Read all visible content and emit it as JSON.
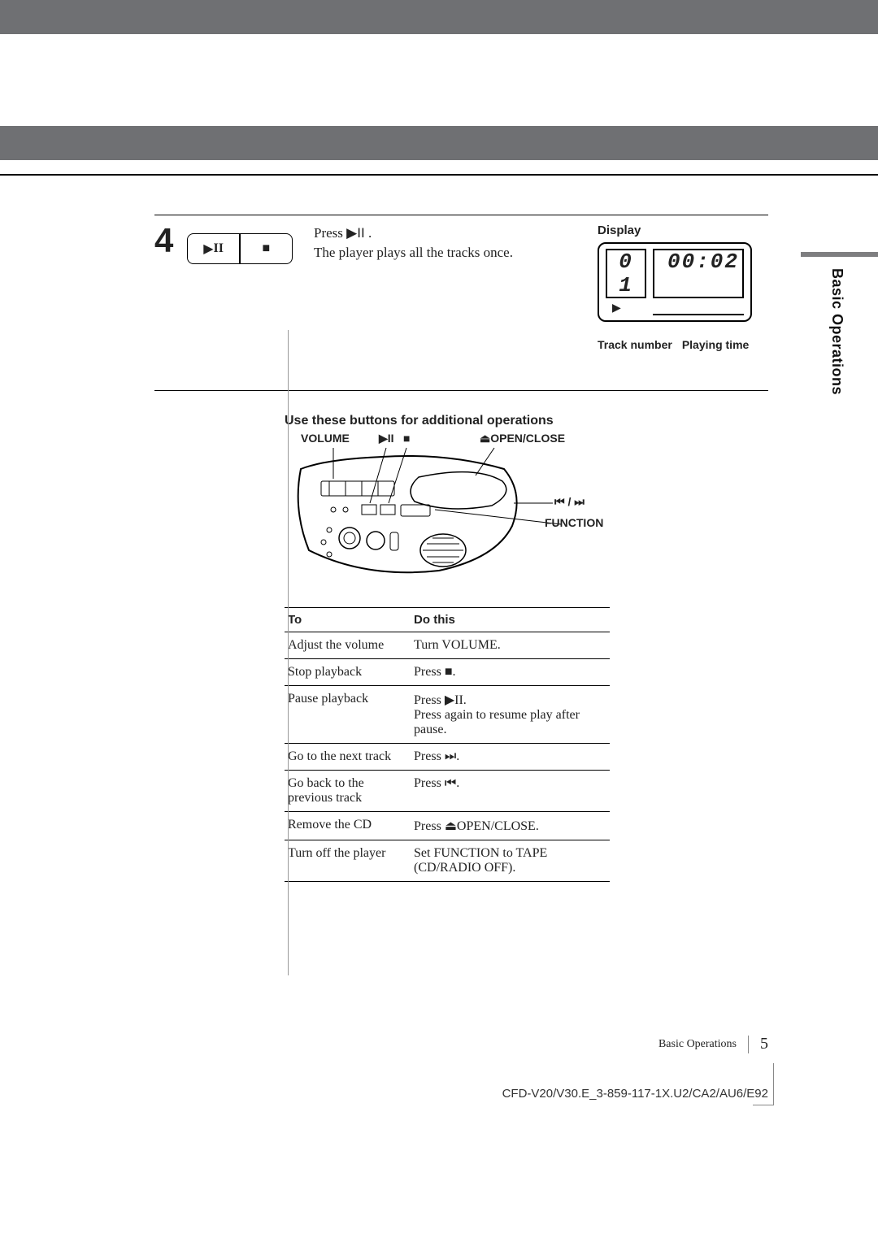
{
  "side_tab": "Basic Operations",
  "step": {
    "number": "4",
    "instruction_line1_prefix": "Press ",
    "instruction_line1_symbol": "▶II",
    "instruction_line1_suffix": " .",
    "instruction_line2": "The  player plays all the tracks once."
  },
  "display": {
    "label": "Display",
    "track": "0 1",
    "time": "00:02",
    "caption_left": "Track number",
    "caption_right": "Playing time"
  },
  "subhead": "Use these buttons for additional operations",
  "device_labels": {
    "volume": "VOLUME",
    "playpause": "▶II",
    "stop": "■",
    "openclose_sym": "⏏",
    "openclose": "OPEN/CLOSE",
    "skip": "⏮ / ⏭",
    "function": "FUNCTION"
  },
  "table": {
    "head_to": "To",
    "head_do": "Do this",
    "rows": [
      {
        "to": "Adjust the volume",
        "do": "Turn VOLUME."
      },
      {
        "to": "Stop playback",
        "do": "Press ■."
      },
      {
        "to": "Pause playback",
        "do": "Press ▶II.\nPress again to resume play after pause."
      },
      {
        "to": "Go to the next track",
        "do": "Press ⏭."
      },
      {
        "to": "Go back to the previous track",
        "do": "Press ⏮."
      },
      {
        "to": "Remove the CD",
        "do": "Press ⏏OPEN/CLOSE."
      },
      {
        "to": "Turn off the player",
        "do": "Set FUNCTION to TAPE (CD/RADIO OFF)."
      }
    ]
  },
  "footer": {
    "section": "Basic Operations",
    "page": "5"
  },
  "doc_id": "CFD-V20/V30.E_3-859-117-1X.U2/CA2/AU6/E92"
}
